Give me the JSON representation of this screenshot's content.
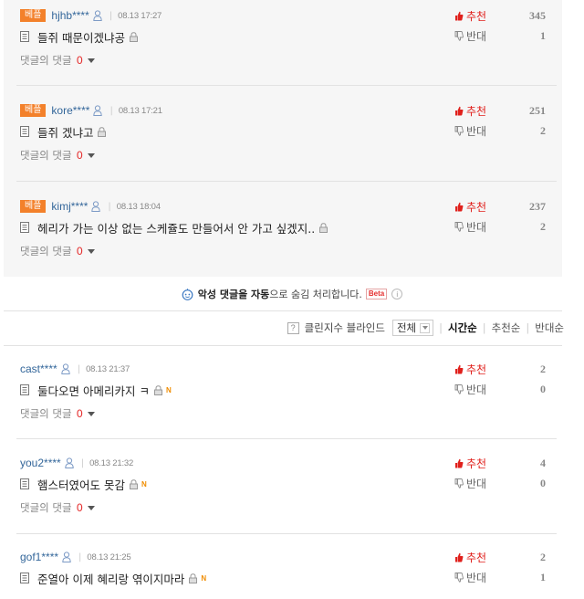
{
  "best_comments": [
    {
      "badge": "베플",
      "author": "hjhb****",
      "time": "08.13 17:27",
      "text": "들쥐 때문이겠냐공",
      "replies_label": "댓글의 댓글",
      "replies_count": "0",
      "up_label": "추천",
      "up_count": "345",
      "down_label": "반대",
      "down_count": "1"
    },
    {
      "badge": "베플",
      "author": "kore****",
      "time": "08.13 17:21",
      "text": "들쥐 겠냐고",
      "replies_label": "댓글의 댓글",
      "replies_count": "0",
      "up_label": "추천",
      "up_count": "251",
      "down_label": "반대",
      "down_count": "2"
    },
    {
      "badge": "베플",
      "author": "kimj****",
      "time": "08.13 18:04",
      "text": "헤리가 가는 이상 없는 스케쥴도 만들어서 안 가고 싶겠지..",
      "replies_label": "댓글의 댓글",
      "replies_count": "0",
      "up_label": "추천",
      "up_count": "237",
      "down_label": "반대",
      "down_count": "2"
    }
  ],
  "notice": {
    "pre": "악성 댓글을 자동",
    "post": "으로 숨김 처리합니다.",
    "beta": "Beta",
    "info": "i"
  },
  "sortbar": {
    "help": "?",
    "filter_label": "클린지수 블라인드",
    "select_value": "전체",
    "options": [
      "시간순",
      "추천순",
      "반대순"
    ]
  },
  "comments": [
    {
      "author": "cast****",
      "time": "08.13 21:37",
      "text": "둘다오면 아메리카지 ㅋ",
      "new": "N",
      "replies_label": "댓글의 댓글",
      "replies_count": "0",
      "up_label": "추천",
      "up_count": "2",
      "down_label": "반대",
      "down_count": "0"
    },
    {
      "author": "you2****",
      "time": "08.13 21:32",
      "text": "햄스터였어도 못감",
      "new": "N",
      "replies_label": "댓글의 댓글",
      "replies_count": "0",
      "up_label": "추천",
      "up_count": "4",
      "down_label": "반대",
      "down_count": "0"
    },
    {
      "author": "gof1****",
      "time": "08.13 21:25",
      "text": "준열아 이제 혜리랑 엮이지마라",
      "new": "N",
      "up_label": "추천",
      "up_count": "2",
      "down_label": "반대",
      "down_count": "1"
    }
  ],
  "colors": {
    "badge": "#f3812b",
    "author": "#33669a",
    "up": "#e0201c",
    "reply_count": "#e52f2f"
  }
}
